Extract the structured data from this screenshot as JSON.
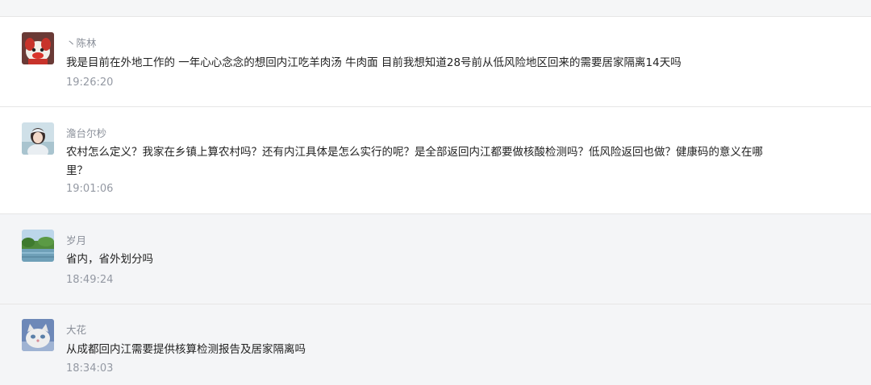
{
  "comments": [
    {
      "author": "丶陈林",
      "avatar_icon": "cartoon-dog-avatar-icon",
      "text": "我是目前在外地工作的   一年心心念念的想回内江吃羊肉汤 牛肉面  目前我想知道28号前从低风险地区回来的需要居家隔离14天吗",
      "time": "19:26:20"
    },
    {
      "author": "澹台尔杪",
      "avatar_icon": "girl-photo-avatar-icon",
      "text": "农村怎么定义？我家在乡镇上算农村吗？还有内江具体是怎么实行的呢？是全部返回内江都要做核酸检测吗？低风险返回也做？健康码的意义在哪里？",
      "time": "19:01:06"
    },
    {
      "author": "岁月",
      "avatar_icon": "landscape-photo-avatar-icon",
      "text": "省内，省外划分吗",
      "time": "18:49:24"
    },
    {
      "author": "大花",
      "avatar_icon": "cat-photo-avatar-icon",
      "text": "从成都回内江需要提供核算检测报告及居家隔离吗",
      "time": "18:34:03"
    }
  ],
  "colors": {
    "name": "#8a8f99",
    "text": "#222222",
    "time": "#9499a3",
    "separator": "#e6e6e6"
  }
}
